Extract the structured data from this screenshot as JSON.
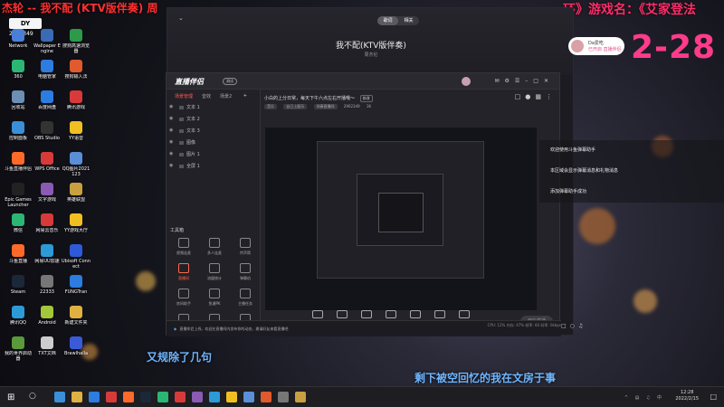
{
  "overlay": {
    "title_left": "杰轮 -- 我不配 (KTV版伴奏) 周",
    "title_right": "环》游戏名：《艾家登法",
    "bg_time": "2-28",
    "badge_number": "2902349",
    "lyric_line1": "又规除了几句",
    "lyric_line2": "剩下被空回忆的我在文房于事"
  },
  "music_player": {
    "tabs": [
      "歌词",
      "相关"
    ],
    "song_title": "我不配(KTV版伴奏)",
    "artist": "周杰伦",
    "user_chip_name": "Da爱吃",
    "user_chip_sub": "已开启 直播伴侣"
  },
  "desktop_icons": [
    {
      "label": "Network",
      "color": "#4a7fd8"
    },
    {
      "label": "Wallpaper Engine",
      "color": "#3a6bb5"
    },
    {
      "label": "搜狗高速浏览器",
      "color": "#2d9a4a"
    },
    {
      "label": "360",
      "color": "#2bb673"
    },
    {
      "label": "电脑管家",
      "color": "#2d7ce0"
    },
    {
      "label": "搜狗输入法",
      "color": "#e05a2d"
    },
    {
      "label": "回收站",
      "color": "#6b8fb5"
    },
    {
      "label": "百度网盘",
      "color": "#2d7ce0"
    },
    {
      "label": "腾讯游戏",
      "color": "#d83a3a"
    },
    {
      "label": "控制面板",
      "color": "#3a8fd8"
    },
    {
      "label": "OBS Studio",
      "color": "#333"
    },
    {
      "label": "YY语音",
      "color": "#f0c020"
    },
    {
      "label": "斗鱼直播伴侣",
      "color": "#ff6a2a"
    },
    {
      "label": "WPS Office",
      "color": "#d83a3a"
    },
    {
      "label": "QQ图片2021123",
      "color": "#5a8fd8"
    },
    {
      "label": "Epic Games Launcher",
      "color": "#222"
    },
    {
      "label": "文字游戏",
      "color": "#8a5ab5"
    },
    {
      "label": "英雄联盟",
      "color": "#c8a040"
    },
    {
      "label": "微信",
      "color": "#2bb673"
    },
    {
      "label": "网易云音乐",
      "color": "#d83a3a"
    },
    {
      "label": "YY游戏大厅",
      "color": "#f0c020"
    },
    {
      "label": "斗鱼直播",
      "color": "#ff6a2a"
    },
    {
      "label": "网易UU加速",
      "color": "#2d9ad8"
    },
    {
      "label": "Ubisoft Connect",
      "color": "#2d5ad8"
    },
    {
      "label": "Steam",
      "color": "#1b2838"
    },
    {
      "label": "22333",
      "color": "#777"
    },
    {
      "label": "FUNGTran",
      "color": "#2d7ce0"
    },
    {
      "label": "腾讯QQ",
      "color": "#2d9ad8"
    },
    {
      "label": "Android",
      "color": "#a4c639"
    },
    {
      "label": "新建文件夹",
      "color": "#e0b040"
    },
    {
      "label": "我的世界启动器",
      "color": "#5a9a3a"
    },
    {
      "label": "TXT文档",
      "color": "#ccc"
    },
    {
      "label": "Brawlhalla",
      "color": "#3a5ad8"
    }
  ],
  "app": {
    "logo": "直播伴侣",
    "logo_badge": "测试",
    "left_tabs": [
      "场景管理",
      "音效",
      "场景2"
    ],
    "scenes": [
      "文本 1",
      "文本 2",
      "文本 3",
      "图像",
      "图片 1",
      "全屏 1"
    ],
    "tools_title": "工具箱",
    "tools": [
      {
        "label": "视频连麦",
        "red": false
      },
      {
        "label": "多人连麦",
        "red": false
      },
      {
        "label": "传声筒",
        "red": false
      },
      {
        "label": "直播间",
        "red": true
      },
      {
        "label": "流量统计",
        "red": false
      },
      {
        "label": "弹幕机",
        "red": false
      },
      {
        "label": "房间助手",
        "red": false
      },
      {
        "label": "鱼塘PK",
        "red": false
      },
      {
        "label": "主播任务",
        "red": false
      },
      {
        "label": "上传一起玩",
        "red": false
      },
      {
        "label": "高能时刻",
        "red": false
      },
      {
        "label": "福利社",
        "red": false
      }
    ],
    "room_title": "小白的上分日常，每天下午六点左右开播哦～",
    "room_edit": "修改",
    "room_meta": [
      "音乐",
      "自己上配乐",
      "伴奏直播间",
      "2902349",
      "36"
    ],
    "bottom_tools": [
      "直播屏幕",
      "摄像头",
      "手机投屏",
      "多媒体",
      "发布直播",
      "话筒设置",
      "直播间"
    ],
    "start_button": "开始直播",
    "stats": "CPU: 12%   内存: 47%   帧率: 60   码率: 0kbps",
    "notice": "直播伴侣上线，欢迎在直播间内发布你的动态，邀请好友来看直播吧"
  },
  "chat": {
    "messages": [
      "欢迎使用斗鱼弹幕助手",
      "本区域会显示弹幕消息和礼物消息",
      "添加弹幕助手成功"
    ]
  },
  "taskbar": {
    "time": "12:28",
    "date": "2022/2/15"
  }
}
